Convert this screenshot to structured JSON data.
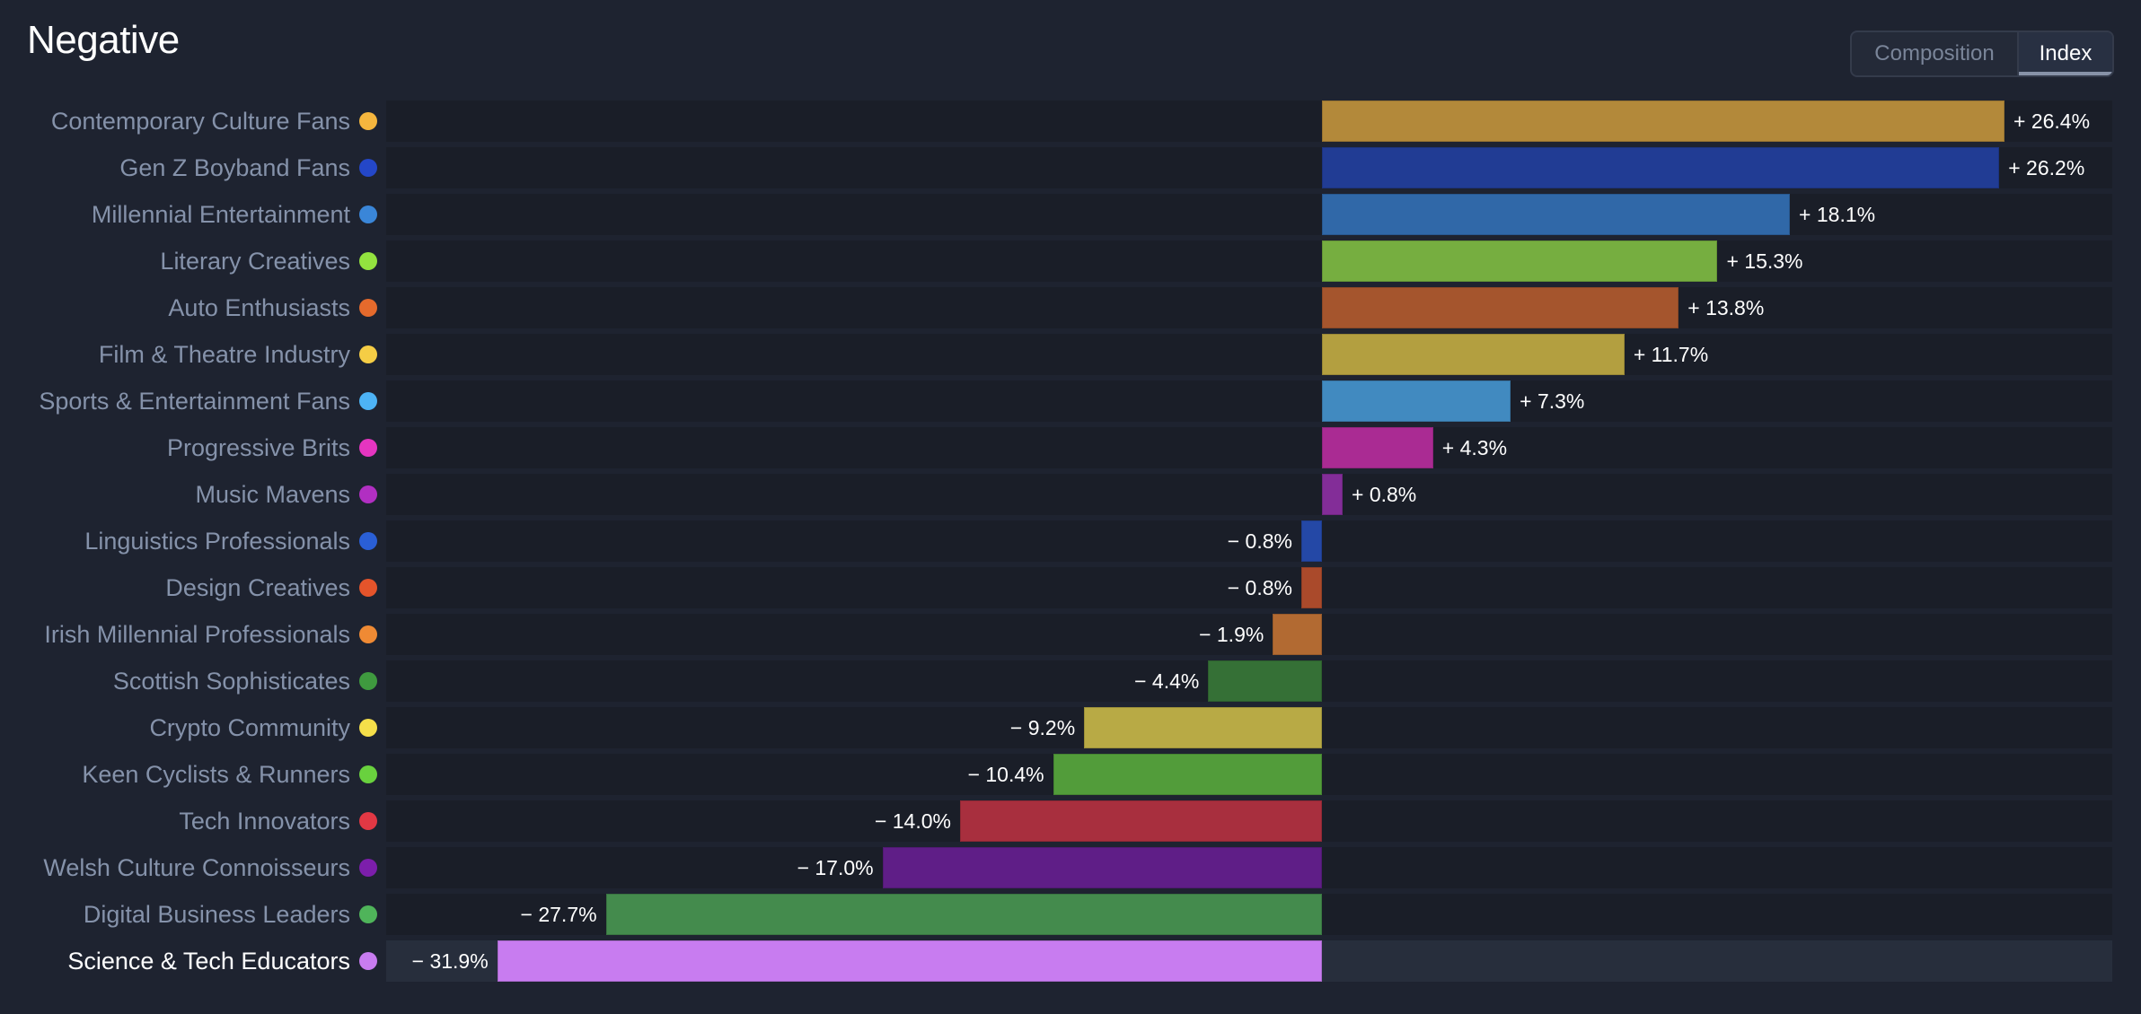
{
  "header": {
    "title": "Negative"
  },
  "view_toggle": {
    "options": [
      {
        "label": "Composition",
        "selected": false
      },
      {
        "label": "Index",
        "selected": true
      }
    ]
  },
  "chart_data": {
    "type": "bar",
    "orientation": "horizontal",
    "title": "Negative",
    "xlabel": "",
    "ylabel": "",
    "value_unit": "%",
    "xlim": [
      -31.9,
      26.4
    ],
    "grid": false,
    "legend": "none (colored dots beside category labels)",
    "highlighted_category": "Science & Tech Educators",
    "categories": [
      "Contemporary Culture Fans",
      "Gen Z Boyband Fans",
      "Millennial Entertainment",
      "Literary Creatives",
      "Auto Enthusiasts",
      "Film & Theatre Industry",
      "Sports & Entertainment Fans",
      "Progressive Brits",
      "Music Mavens",
      "Linguistics Professionals",
      "Design Creatives",
      "Irish Millennial Professionals",
      "Scottish Sophisticates",
      "Crypto Community",
      "Keen Cyclists & Runners",
      "Tech Innovators",
      "Welsh Culture Connoisseurs",
      "Digital Business Leaders",
      "Science & Tech Educators"
    ],
    "values": [
      26.4,
      26.2,
      18.1,
      15.3,
      13.8,
      11.7,
      7.3,
      4.3,
      0.8,
      -0.8,
      -0.8,
      -1.9,
      -4.4,
      -9.2,
      -10.4,
      -14.0,
      -17.0,
      -27.7,
      -31.9
    ],
    "value_labels": [
      "+ 26.4%",
      "+ 26.2%",
      "+ 18.1%",
      "+ 15.3%",
      "+ 13.8%",
      "+ 11.7%",
      "+ 7.3%",
      "+ 4.3%",
      "+ 0.8%",
      "− 0.8%",
      "− 0.8%",
      "− 1.9%",
      "− 4.4%",
      "− 9.2%",
      "− 10.4%",
      "− 14.0%",
      "− 17.0%",
      "− 27.7%",
      "− 31.9%"
    ],
    "dot_colors": [
      "#f5b63e",
      "#2447c8",
      "#3a86d8",
      "#93e23f",
      "#e56a2c",
      "#f5cd45",
      "#4db3f5",
      "#e535c0",
      "#b12fc2",
      "#2a5fd6",
      "#e5542b",
      "#ef8a34",
      "#3f9a3f",
      "#f5df4a",
      "#69d13e",
      "#e23844",
      "#7c1eab",
      "#4fb45a",
      "#c87cf0"
    ],
    "bar_colors": [
      "#b3893a",
      "#213c94",
      "#3068a8",
      "#76ae40",
      "#a5552d",
      "#b39f40",
      "#418ac0",
      "#aa2b93",
      "#832d98",
      "#2448a6",
      "#aa4a2b",
      "#b26a32",
      "#357036",
      "#b8aa45",
      "#529c3a",
      "#a82f3e",
      "#5f1e87",
      "#448b4d",
      "#c87cf0"
    ]
  }
}
